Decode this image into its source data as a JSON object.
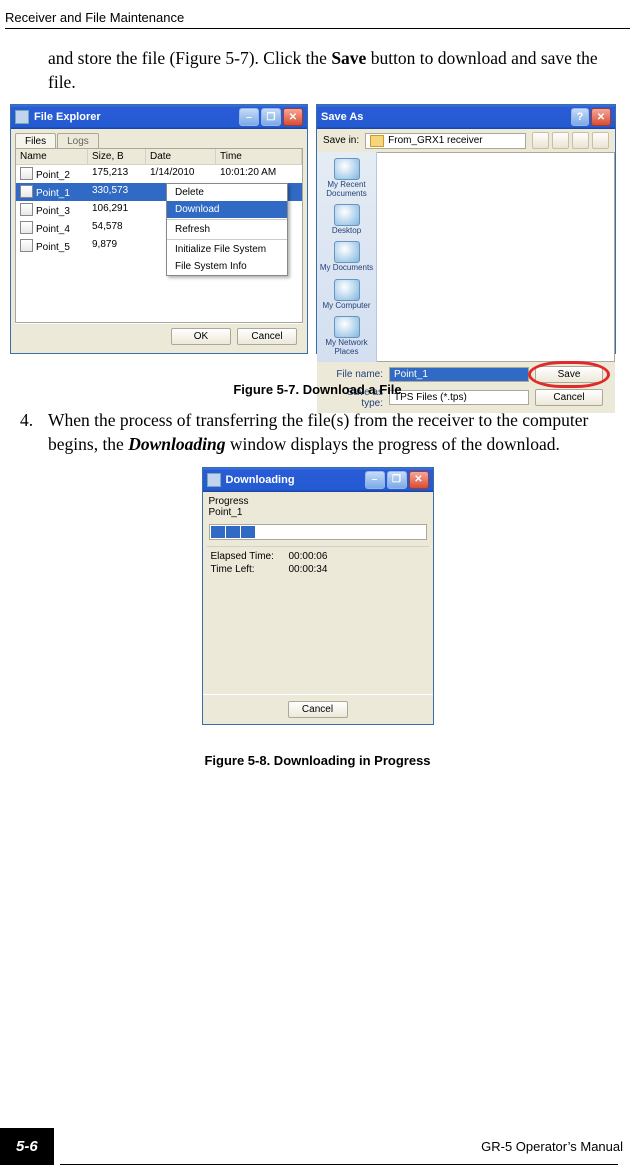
{
  "header": {
    "title": "Receiver and File Maintenance"
  },
  "para1": {
    "pre": "and store the file (Figure 5-7). Click the ",
    "bold": "Save",
    "post": " button to download and save the file."
  },
  "fileExplorer": {
    "title": "File Explorer",
    "tabs": {
      "files": "Files",
      "logs": "Logs"
    },
    "cols": {
      "name": "Name",
      "size": "Size, B",
      "date": "Date",
      "time": "Time"
    },
    "rows": [
      {
        "name": "Point_2",
        "size": "175,213",
        "date": "1/14/2010",
        "time": "10:01:20 AM"
      },
      {
        "name": "Point_1",
        "size": "330,573",
        "date": "",
        "time": ""
      },
      {
        "name": "Point_3",
        "size": "106,291",
        "date": "",
        "time": ""
      },
      {
        "name": "Point_4",
        "size": "54,578",
        "date": "",
        "time": ""
      },
      {
        "name": "Point_5",
        "size": "9,879",
        "date": "",
        "time": ""
      }
    ],
    "ctx": {
      "delete": "Delete",
      "download": "Download",
      "refresh": "Refresh",
      "init": "Initialize File System",
      "info": "File System Info"
    },
    "ok": "OK",
    "cancel": "Cancel"
  },
  "saveAs": {
    "title": "Save As",
    "saveInLabel": "Save in:",
    "saveInValue": "From_GRX1 receiver",
    "side": {
      "recent": "My Recent Documents",
      "desktop": "Desktop",
      "docs": "My Documents",
      "computer": "My Computer",
      "network": "My Network Places"
    },
    "fileNameLabel": "File name:",
    "fileNameValue": "Point_1",
    "saveTypeLabel": "Save as type:",
    "saveTypeValue": "TPS Files (*.tps)",
    "save": "Save",
    "cancel": "Cancel"
  },
  "cap57": "Figure 5-7. Download a File",
  "para2": {
    "num": "4.",
    "pre": "When the process of transferring the file(s) from the receiver to the computer begins, the ",
    "bi": "Downloading",
    "post": " window displays the progress of the download."
  },
  "downloading": {
    "title": "Downloading",
    "progress": "Progress",
    "file": "Point_1",
    "elapsedLabel": "Elapsed Time:",
    "elapsedValue": "00:00:06",
    "leftLabel": "Time Left:",
    "leftValue": "00:00:34",
    "cancel": "Cancel"
  },
  "cap58": "Figure 5-8. Downloading in Progress",
  "footer": {
    "page": "5-6",
    "manual": "GR-5 Operator’s Manual"
  }
}
